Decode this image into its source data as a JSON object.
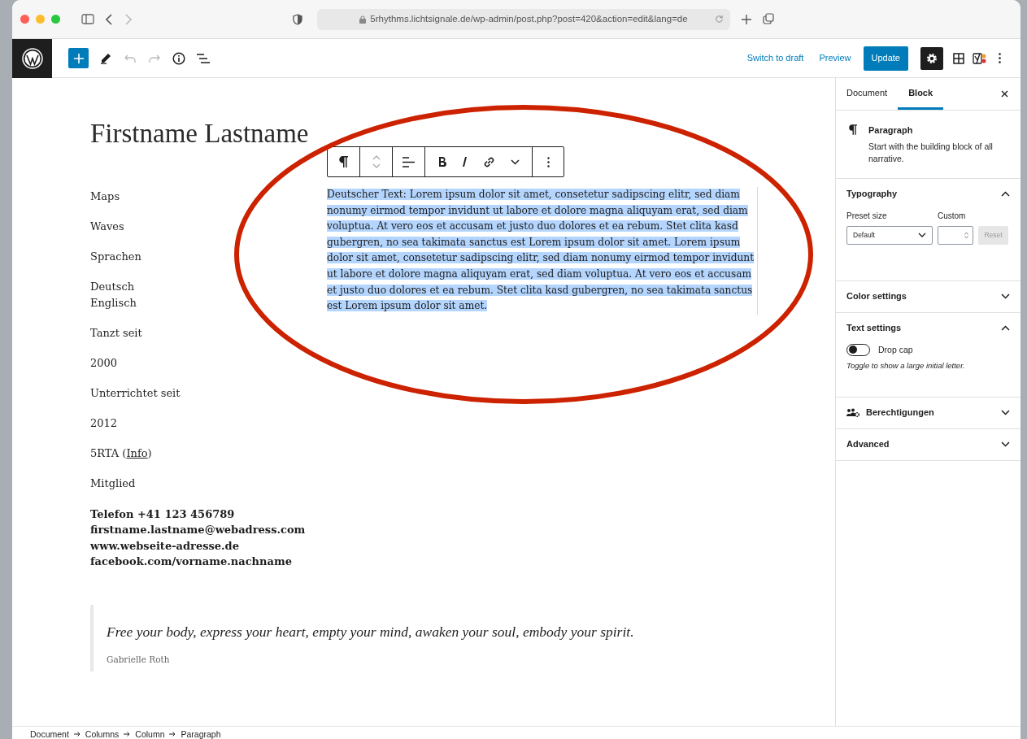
{
  "browser": {
    "url": "5rhythms.lichtsignale.de/wp-admin/post.php?post=420&action=edit&lang=de"
  },
  "toolbar": {
    "switch_to_draft": "Switch to draft",
    "preview": "Preview",
    "update": "Update",
    "settings_selected": true
  },
  "editor": {
    "title": "Firstname Lastname",
    "left_column": [
      {
        "kind": "plain",
        "lines": [
          "Maps"
        ]
      },
      {
        "kind": "plain",
        "lines": [
          "Waves"
        ]
      },
      {
        "kind": "plain",
        "lines": [
          "Sprachen"
        ]
      },
      {
        "kind": "plain",
        "lines": [
          "Deutsch",
          "Englisch"
        ]
      },
      {
        "kind": "plain",
        "lines": [
          "Tanzt seit"
        ]
      },
      {
        "kind": "plain",
        "lines": [
          "2000"
        ]
      },
      {
        "kind": "plain",
        "lines": [
          "Unterrichtet seit"
        ]
      },
      {
        "kind": "plain",
        "lines": [
          "2012"
        ]
      },
      {
        "kind": "link",
        "prefix": "5RTA (",
        "link": "Info",
        "suffix": ")"
      },
      {
        "kind": "plain",
        "lines": [
          "Mitglied"
        ]
      },
      {
        "kind": "bold",
        "lines": [
          "Telefon +41 123 456789",
          "firstname.lastname@webadress.com",
          "www.webseite-adresse.de",
          "facebook.com/vorname.nachname"
        ]
      }
    ],
    "paragraph": {
      "text": "Deutscher Text: Lorem ipsum dolor sit amet, consetetur sadipscing elitr, sed diam nonumy eirmod tempor invidunt ut labore et dolore magna aliquyam erat, sed diam voluptua. At vero eos et accusam et justo duo dolores et ea rebum. Stet clita kasd gubergren, no sea takimata sanctus est Lorem ipsum dolor sit amet. Lorem ipsum dolor sit amet, consetetur sadipscing elitr, sed diam nonumy eirmod tempor invidunt ut labore et dolore magna aliquyam erat, sed diam voluptua. At vero eos et accusam et justo duo dolores et ea rebum. Stet clita kasd gubergren, no sea takimata sanctus est Lorem ipsum dolor sit amet.",
      "selected": true
    },
    "quote": {
      "text": "Free your body, express your heart, empty your mind, awaken your soul, embody your spirit.",
      "citation": "Gabrielle Roth"
    }
  },
  "sidebar": {
    "tabs": [
      {
        "label": "Document",
        "selected": false
      },
      {
        "label": "Block",
        "selected": true
      }
    ],
    "block": {
      "name": "Paragraph",
      "description": "Start with the building block of all narrative."
    },
    "panels": [
      {
        "kind": "typography",
        "title": "Typography",
        "expanded": true,
        "preset_label": "Preset size",
        "preset_value": "Default",
        "custom_label": "Custom",
        "reset": "Reset"
      },
      {
        "kind": "plain",
        "title": "Color settings",
        "expanded": false
      },
      {
        "kind": "text",
        "title": "Text settings",
        "expanded": true,
        "toggle_label": "Drop cap",
        "checked": false,
        "help": "Toggle to show a large initial letter."
      },
      {
        "kind": "permissions",
        "title": "Berechtigungen",
        "expanded": false
      },
      {
        "kind": "plain",
        "title": "Advanced",
        "expanded": false
      }
    ]
  },
  "breadcrumb": [
    "Document",
    "Columns",
    "Column",
    "Paragraph"
  ]
}
